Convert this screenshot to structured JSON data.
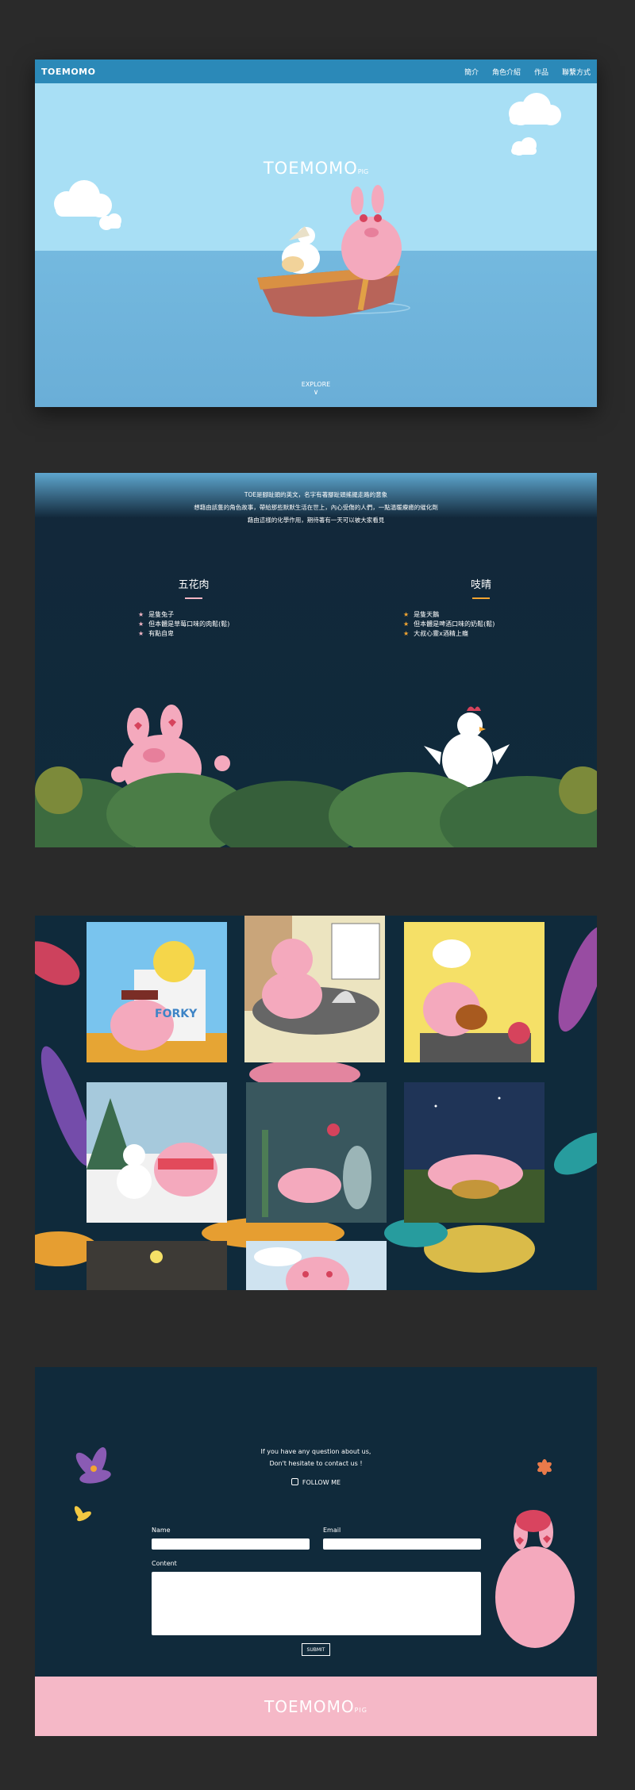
{
  "site": {
    "logo": "TOEMOMO",
    "menu": [
      "簡介",
      "角色介紹",
      "作品",
      "聯繫方式"
    ]
  },
  "hero": {
    "title": "TOEMOMO",
    "title_suffix": "PIG",
    "explore": "EXPLORE",
    "arrow": "∨"
  },
  "characters": {
    "intro_lines": [
      "TOE是腳趾頭的英文，名字有著腳趾頭搖擺走路的意象",
      "想藉由該隻的角色故事，帶給那些默默生活在世上，內心受傷的人們，一點溫暖療癒的催化劑",
      "藉由這樣的化學作用，期待著有一天可以被大家看見"
    ],
    "items": [
      {
        "name": "五花肉",
        "bar_color": "#f3b6c4",
        "star_color": "#f3b6c4",
        "traits": [
          "是隻兔子",
          "但本體是草莓口味的肉鬆(鬆)",
          "有點自卑"
        ]
      },
      {
        "name": "吱晴",
        "bar_color": "#f3a531",
        "star_color": "#f3a531",
        "traits": [
          "是隻天鵝",
          "但本體是啤酒口味的奶鬆(鬆)",
          "大叔心靈x酒精上癮"
        ]
      }
    ]
  },
  "gallery": {
    "tiles": [
      {
        "name": "gallery-item-forky",
        "text": "FORKY"
      },
      {
        "name": "gallery-item-jelly"
      },
      {
        "name": "gallery-item-chef"
      },
      {
        "name": "gallery-item-snowman"
      },
      {
        "name": "gallery-item-greenhouse"
      },
      {
        "name": "gallery-item-night-sleep"
      },
      {
        "name": "gallery-item-lamp"
      },
      {
        "name": "gallery-item-sunflower"
      }
    ]
  },
  "contact": {
    "question_line1": "If you have any question about us,",
    "question_line2": "Don't hesitate to contact us !",
    "follow_label": "FOLLOW ME",
    "name_label": "Name",
    "email_label": "Email",
    "content_label": "Content",
    "submit_label": "SUBMIT"
  },
  "footer": {
    "title": "TOEMOMO",
    "suffix": "PIG"
  },
  "colors": {
    "nav": "#2b89b8",
    "dark": "#0f2a3b",
    "pink": "#f5b8c7",
    "sky": "#a8dff5"
  }
}
